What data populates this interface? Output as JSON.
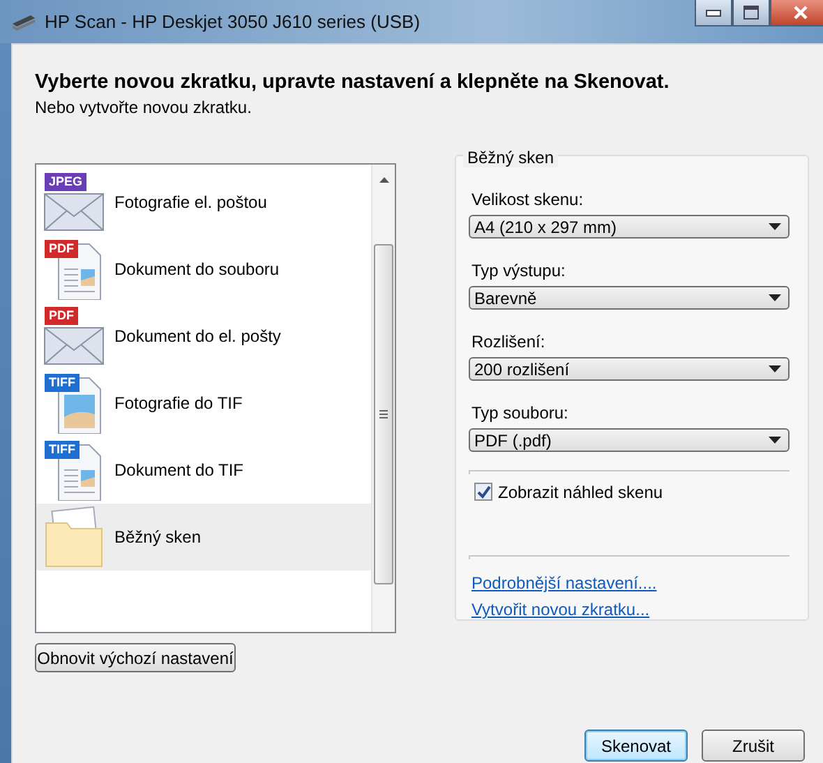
{
  "window": {
    "title": "HP Scan - HP Deskjet 3050 J610 series (USB)"
  },
  "heading": "Vyberte novou zkratku, upravte nastavení a klepněte na Skenovat.",
  "subheading": "Nebo vytvořte novou zkratku.",
  "shortcuts": [
    {
      "label": "Fotografie el. poštou",
      "kind": "envelope",
      "badge": "JPEG",
      "color": "#6a3fb5",
      "selected": false
    },
    {
      "label": "Dokument do souboru",
      "kind": "document",
      "badge": "PDF",
      "color": "#d02a2a",
      "selected": false
    },
    {
      "label": "Dokument do el. pošty",
      "kind": "envelope",
      "badge": "PDF",
      "color": "#d02a2a",
      "selected": false
    },
    {
      "label": "Fotografie do TIF",
      "kind": "photo",
      "badge": "TIFF",
      "color": "#1f6fd0",
      "selected": false
    },
    {
      "label": "Dokument do TIF",
      "kind": "document",
      "badge": "TIFF",
      "color": "#1f6fd0",
      "selected": false
    },
    {
      "label": "Běžný sken",
      "kind": "folder",
      "selected": true
    }
  ],
  "settings": {
    "title": "Běžný sken",
    "fields": [
      {
        "label": "Velikost skenu:",
        "value": "A4 (210 x 297 mm)"
      },
      {
        "label": "Typ výstupu:",
        "value": "Barevně"
      },
      {
        "label": "Rozlišení:",
        "value": "200 rozlišení"
      },
      {
        "label": "Typ souboru:",
        "value": "PDF (.pdf)"
      }
    ],
    "preview": {
      "label": "Zobrazit náhled skenu",
      "checked": true
    },
    "links": [
      "Podrobnější nastavení....",
      "Vytvořit novou zkratku..."
    ]
  },
  "reset_button": "Obnovit výchozí nastavení",
  "buttons": [
    {
      "label": "Skenovat",
      "default": true
    },
    {
      "label": "Zrušit",
      "default": false
    }
  ]
}
